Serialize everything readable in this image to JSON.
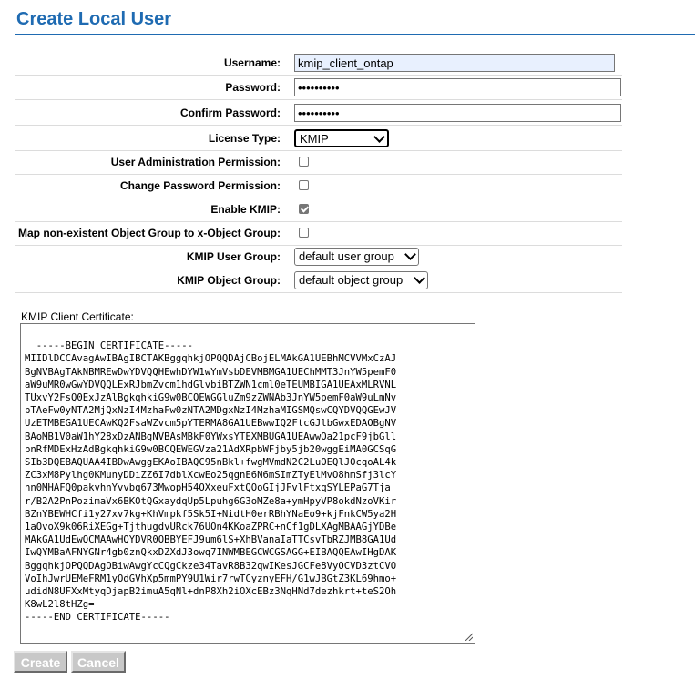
{
  "page": {
    "title": "Create Local User"
  },
  "form": {
    "username": {
      "label": "Username:",
      "value": "kmip_client_ontap"
    },
    "password": {
      "label": "Password:",
      "value": "••••••••••"
    },
    "confirm_password": {
      "label": "Confirm Password:",
      "value": "••••••••••"
    },
    "license_type": {
      "label": "License Type:",
      "selected": "KMIP"
    },
    "user_admin_permission": {
      "label": "User Administration Permission:",
      "checked": false
    },
    "change_password_permission": {
      "label": "Change Password Permission:",
      "checked": false
    },
    "enable_kmip": {
      "label": "Enable KMIP:",
      "checked": true
    },
    "map_object_group": {
      "label": "Map non-existent Object Group to x-Object Group:",
      "checked": false
    },
    "kmip_user_group": {
      "label": "KMIP User Group:",
      "selected": "default user group"
    },
    "kmip_object_group": {
      "label": "KMIP Object Group:",
      "selected": "default object group"
    }
  },
  "certificate": {
    "label": "KMIP Client Certificate:",
    "text": "-----BEGIN CERTIFICATE-----\nMIIDlDCCAvagAwIBAgIBCTAKBggqhkjOPQQDAjCBojELMAkGA1UEBhMCVVMxCzAJ\nBgNVBAgTAkNBMREwDwYDVQQHEwhDYW1wYmVsbDEVMBMGA1UEChMMT3JnYW5pemF0\naW9uMR0wGwYDVQQLExRJbmZvcm1hdGlvbiBTZWN1cml0eTEUMBIGA1UEAxMLRVNL\nTUxvY2FsQ0ExJzAlBgkqhkiG9w0BCQEWGGluZm9zZWNAb3JnYW5pemF0aW9uLmNv\nbTAeFw0yNTA2MjQxNzI4MzhaFw0zNTA2MDgxNzI4MzhaMIGSMQswCQYDVQQGEwJV\nUzETMBEGA1UECAwKQ2FsaWZvcm5pYTERMA8GA1UEBwwIQ2FtcGJlbGwxEDAOBgNV\nBAoMB1V0aW1hY28xDzANBgNVBAsMBkF0YWxsYTEXMBUGA1UEAwwOa21pcF9jbGll\nbnRfMDExHzAdBgkqhkiG9w0BCQEWEGVza21AdXRpbWFjby5jb20wggEiMA0GCSqG\nSIb3DQEBAQUAA4IBDwAwggEKAoIBAQC95nBkl+fwgMVmdN2C2LuOEQlJOcqoAL4k\nZC3xM8Pylhg0KMunyDDiZZ6I7dblXcwEo25qgnE6N6mSImZTyElMvO8hmSfj3lcY\nhn0MHAFQ0pakvhnYvvbq673MwopH54OXxeuFxtQOoGIjJFvlFtxqSYLEPaG7Tja\nr/B2A2PnPozimaVx6BKOtQGxaydqUp5Lpuhg6G3oMZe8a+ymHpyVP8okdNzoVKir\nBZnYBEWHCfi1y27xv7kg+KhVmpkf5Sk5I+NidtH0erRBhYNaEo9+kjFnkCW5ya2H\n1aOvoX9k06RiXEGg+TjthugdvURck76UOn4KKoaZPRC+nCf1gDLXAgMBAAGjYDBe\nMAkGA1UdEwQCMAAwHQYDVR0OBBYEFJ9um6lS+XhBVanaIaTTCsvTbRZJMB8GA1Ud\nIwQYMBaAFNYGNr4gb0znQkxDZXdJ3owq7INWMBEGCWCGSAGG+EIBAQQEAwIHgDAK\nBggqhkjOPQQDAgOBiwAwgYcCQgCkze34TavR8B32qwIKesJGCFe8VyOCVD3ztCVO\nVoIhJwrUEMeFRM1yOdGVhXp5mmPY9U1Wir7rwTCyznyEFH/G1wJBGtZ3KL69hmo+\nudidN8UFXxMtyqDjapB2imuA5qNl+dnP8Xh2iOXcEBz3NqHNd7dezhkrt+teS2Oh\nK8wL2l8tHZg=\n-----END CERTIFICATE-----"
  },
  "buttons": {
    "create": "Create",
    "cancel": "Cancel"
  }
}
